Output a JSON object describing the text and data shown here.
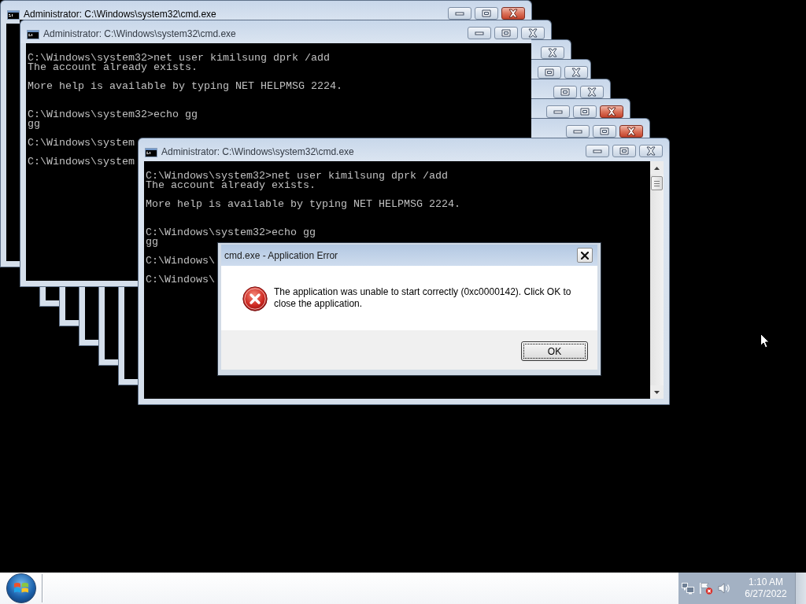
{
  "desktop": {
    "windows": [
      {
        "title": "Administrator: C:\\Windows\\system32\\cmd.exe",
        "active": true
      },
      {
        "title": "Administrator: C:\\Windows\\system32\\cmd.exe",
        "active": false,
        "output": [
          {
            "kind": "command",
            "lines": [
              "C:\\Windows\\system32>net user kimilsung dprk /add",
              "The account already exists."
            ]
          },
          {
            "kind": "notice",
            "lines": [
              "More help is available by typing NET HELPMSG 2224."
            ]
          },
          {
            "kind": "command",
            "lines": [
              "C:\\Windows\\system32>echo gg",
              "gg"
            ]
          },
          {
            "kind": "prompt",
            "lines": [
              "C:\\Windows\\system"
            ]
          },
          {
            "kind": "prompt",
            "lines": [
              "C:\\Windows\\system"
            ]
          }
        ]
      },
      {
        "active": false
      },
      {
        "active": false
      },
      {
        "active": false
      },
      {
        "active": true
      },
      {
        "active": true
      },
      {
        "title": "Administrator: C:\\Windows\\system32\\cmd.exe",
        "active": false,
        "output": [
          {
            "kind": "command",
            "lines": [
              "C:\\Windows\\system32>net user kimilsung dprk /add",
              "The account already exists."
            ]
          },
          {
            "kind": "notice",
            "lines": [
              "More help is available by typing NET HELPMSG 2224."
            ]
          },
          {
            "kind": "command",
            "lines": [
              "C:\\Windows\\system32>echo gg",
              "gg"
            ]
          },
          {
            "kind": "prompt",
            "lines": [
              "C:\\Windows\\"
            ]
          },
          {
            "kind": "prompt",
            "lines": [
              "C:\\Windows\\"
            ]
          }
        ]
      }
    ]
  },
  "dialog": {
    "title": "cmd.exe - Application Error",
    "message": "The application was unable to start correctly (0xc0000142). Click OK to close the application.",
    "button": "OK"
  },
  "taskbar": {
    "clock": {
      "time": "1:10 AM",
      "date": "6/27/2022"
    }
  }
}
